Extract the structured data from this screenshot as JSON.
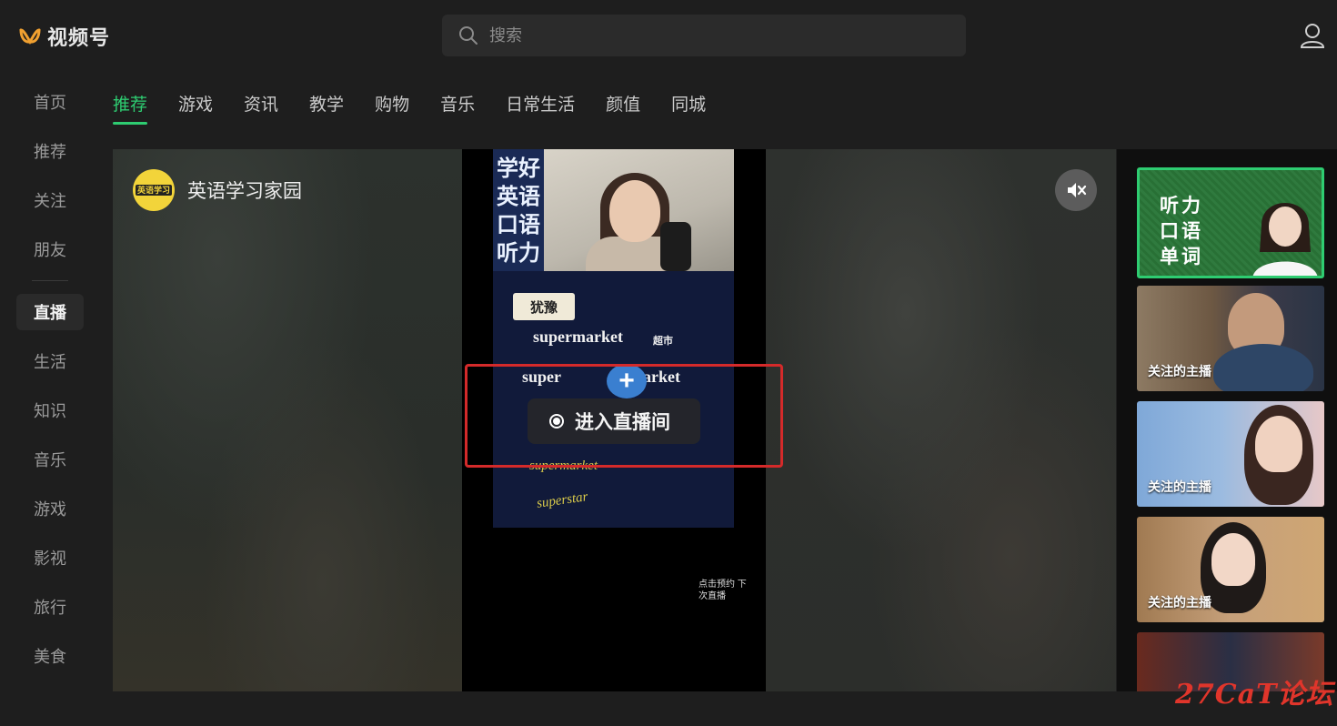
{
  "app": {
    "title": "视频号"
  },
  "search": {
    "placeholder": "搜索"
  },
  "sidebar": {
    "items": [
      {
        "label": "首页"
      },
      {
        "label": "推荐"
      },
      {
        "label": "关注"
      },
      {
        "label": "朋友"
      },
      {
        "label": "直播",
        "active": true
      },
      {
        "label": "生活"
      },
      {
        "label": "知识"
      },
      {
        "label": "音乐"
      },
      {
        "label": "游戏"
      },
      {
        "label": "影视"
      },
      {
        "label": "旅行"
      },
      {
        "label": "美食"
      }
    ]
  },
  "tabs": [
    {
      "label": "推荐",
      "active": true
    },
    {
      "label": "游戏"
    },
    {
      "label": "资讯"
    },
    {
      "label": "教学"
    },
    {
      "label": "购物"
    },
    {
      "label": "音乐"
    },
    {
      "label": "日常生活"
    },
    {
      "label": "颜值"
    },
    {
      "label": "同城"
    }
  ],
  "player": {
    "channel_name": "英语学习家园",
    "channel_avatar_text": "英语学习",
    "enter_live_label": "进入直播间",
    "video_overlay": {
      "slogan": "学好英语口语听力",
      "tag": "犹豫",
      "word_full": "supermarket",
      "word_full_cn": "超市",
      "word_part_a": "super",
      "word_part_b": "market",
      "scribble_1": "supermarket",
      "scribble_2": "superstar",
      "small_note": "点击预约 下次直播"
    }
  },
  "recommendations": [
    {
      "featured_text": "听力\n口语\n单词",
      "label": ""
    },
    {
      "label": "关注的主播"
    },
    {
      "label": "关注的主播"
    },
    {
      "label": "关注的主播"
    },
    {
      "label": ""
    }
  ],
  "watermark": "27CaT论坛",
  "colors": {
    "accent": "#2ecc71",
    "highlight": "#d42a2a",
    "background": "#1e1e1e"
  }
}
